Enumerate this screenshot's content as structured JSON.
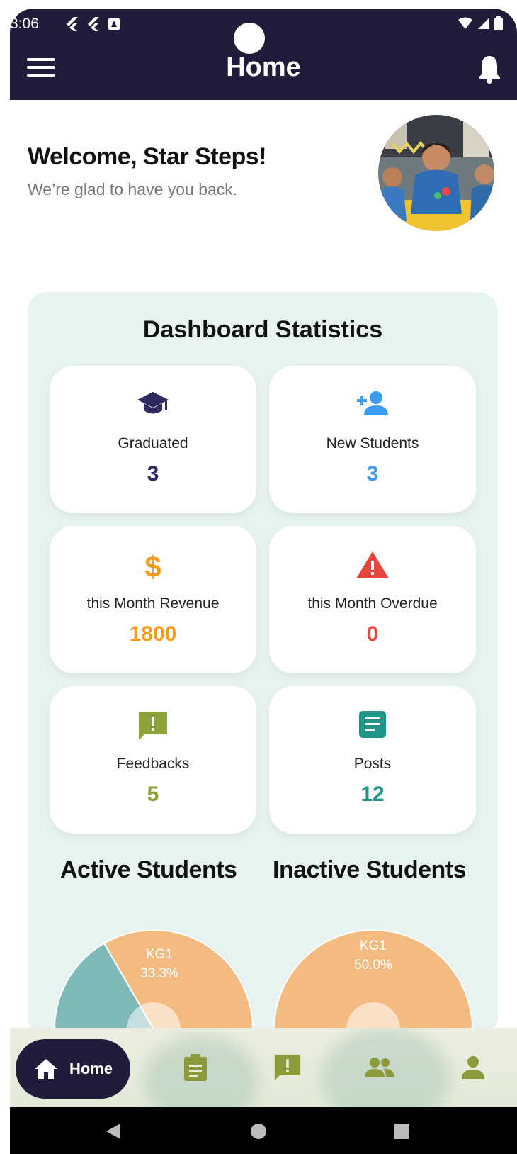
{
  "status_bar": {
    "time": "3:06"
  },
  "app_bar": {
    "title": "Home"
  },
  "welcome": {
    "title": "Welcome, Star Steps!",
    "subtitle": "We’re glad to have you back."
  },
  "dashboard": {
    "title": "Dashboard Statistics",
    "cards": [
      {
        "label": "Graduated",
        "value": "3",
        "icon": "graduation-cap-icon",
        "color": "#2d2a5e"
      },
      {
        "label": "New Students",
        "value": "3",
        "icon": "person-add-icon",
        "color": "#3b9bf0"
      },
      {
        "label": "this Month Revenue",
        "value": "1800",
        "icon": "dollar-icon",
        "color": "#f59b1c"
      },
      {
        "label": "this Month Overdue",
        "value": "0",
        "icon": "warning-icon",
        "color": "#e8453c"
      },
      {
        "label": "Feedbacks",
        "value": "5",
        "icon": "feedback-icon",
        "color": "#8ca23a"
      },
      {
        "label": "Posts",
        "value": "12",
        "icon": "article-icon",
        "color": "#1e9688"
      }
    ]
  },
  "charts": {
    "active_title": "Active Students",
    "inactive_title": "Inactive Students"
  },
  "chart_data": [
    {
      "type": "pie",
      "title": "Active Students",
      "slices": [
        {
          "label": "KG1",
          "percent_label": "33.3%",
          "value": 33.3,
          "color": "#f4bb80"
        },
        {
          "label": "",
          "percent_label": "",
          "value": 66.7,
          "color": "#7fb9b7"
        }
      ]
    },
    {
      "type": "pie",
      "title": "Inactive Students",
      "slices": [
        {
          "label": "KG1",
          "percent_label": "50.0%",
          "value": 50.0,
          "color": "#f4bb80"
        },
        {
          "label": "",
          "percent_label": "",
          "value": 50.0,
          "color": "#f4bb80"
        }
      ]
    }
  ],
  "bottom_nav": {
    "home_label": "Home",
    "items": [
      "assignment-icon",
      "feedback-icon",
      "group-icon",
      "person-icon"
    ],
    "icon_color": "#8c9a3c"
  },
  "colors": {
    "primary": "#221c3b",
    "panel": "#e6f3f1"
  }
}
